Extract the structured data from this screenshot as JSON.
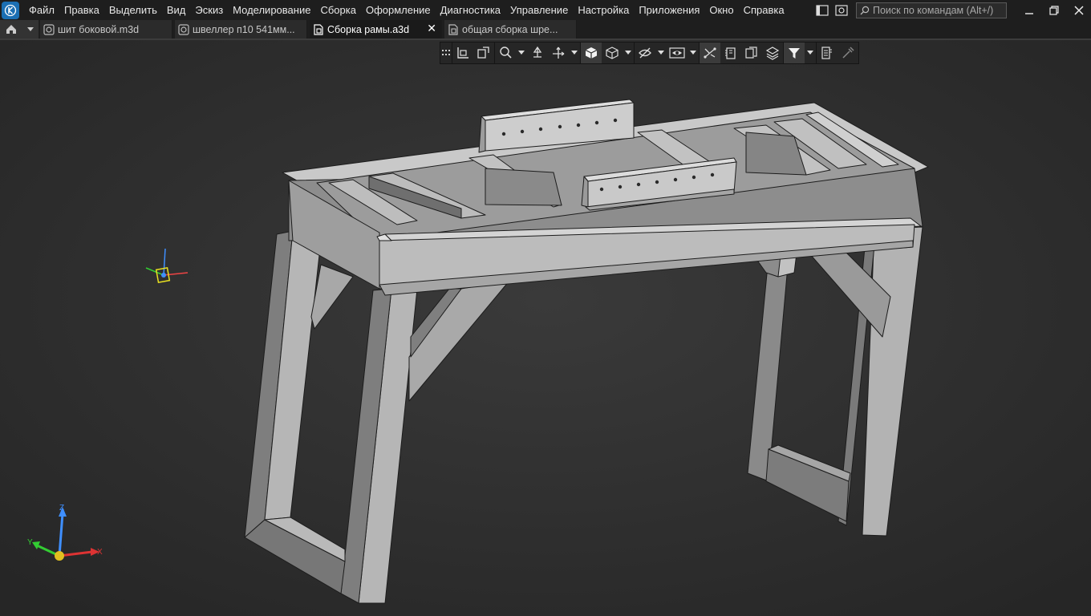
{
  "menu": {
    "items": [
      "Файл",
      "Правка",
      "Выделить",
      "Вид",
      "Эскиз",
      "Моделирование",
      "Сборка",
      "Оформление",
      "Диагностика",
      "Управление",
      "Настройка",
      "Приложения",
      "Окно",
      "Справка"
    ],
    "search_placeholder": "Поиск по командам (Alt+/)"
  },
  "tabs": [
    {
      "label": "шит боковой.m3d",
      "icon": "part-icon",
      "active": false
    },
    {
      "label": "швеллер п10 541мм...",
      "icon": "part-icon",
      "active": false
    },
    {
      "label": "Сборка рамы.a3d",
      "icon": "assembly-icon",
      "active": true
    },
    {
      "label": "общая сборка  шре...",
      "icon": "assembly-icon",
      "active": false
    }
  ],
  "tab_close": "✕",
  "view_toolbar": [
    "grid-handle-icon",
    "view-orientation-icon",
    "local-cs-icon",
    "zoom-icon",
    "rotate-icon",
    "pan-icon",
    "shaded-icon",
    "wireframe-icon",
    "hide-icon",
    "visibility-icon",
    "section-icon",
    "measure-icon",
    "layers-icon",
    "filter-icon",
    "properties-icon",
    "pipette-icon"
  ],
  "triad": {
    "x": "X",
    "y": "Y",
    "z": "Z"
  },
  "colors": {
    "accent": "#1b6fb3",
    "model_light": "#b9b9b9",
    "model_mid": "#9a9a9a",
    "model_dark": "#6e6e6e",
    "background": "#2f2f2f"
  }
}
